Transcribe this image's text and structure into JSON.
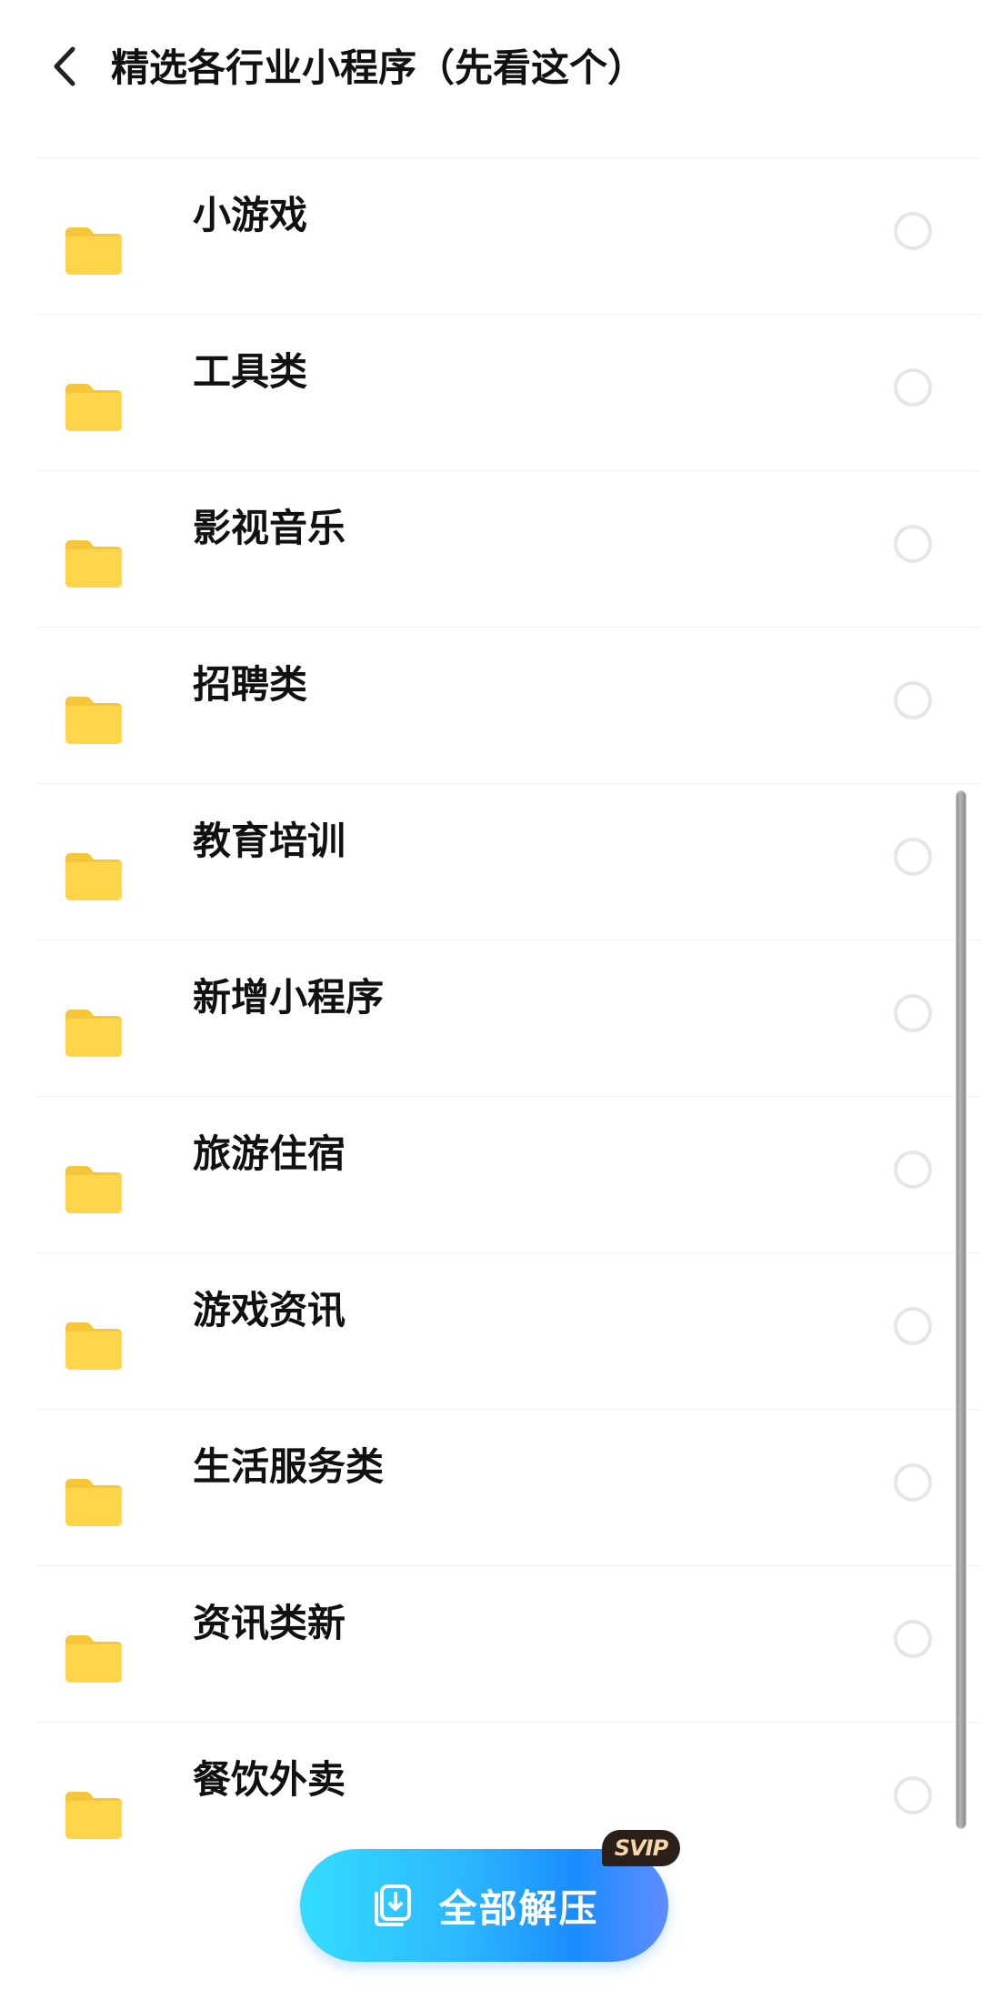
{
  "header": {
    "title": "精选各行业小程序（先看这个）",
    "back_icon": "chevron-left-icon"
  },
  "files": [
    {
      "name": "小游戏",
      "icon": "folder-icon",
      "selected": false
    },
    {
      "name": "工具类",
      "icon": "folder-icon",
      "selected": false
    },
    {
      "name": "影视音乐",
      "icon": "folder-icon",
      "selected": false
    },
    {
      "name": "招聘类",
      "icon": "folder-icon",
      "selected": false
    },
    {
      "name": "教育培训",
      "icon": "folder-icon",
      "selected": false
    },
    {
      "name": "新增小程序",
      "icon": "folder-icon",
      "selected": false
    },
    {
      "name": "旅游住宿",
      "icon": "folder-icon",
      "selected": false
    },
    {
      "name": "游戏资讯",
      "icon": "folder-icon",
      "selected": false
    },
    {
      "name": "生活服务类",
      "icon": "folder-icon",
      "selected": false
    },
    {
      "name": "资讯类新",
      "icon": "folder-icon",
      "selected": false
    },
    {
      "name": "餐饮外卖",
      "icon": "folder-icon",
      "selected": false
    }
  ],
  "footer": {
    "extract_label": "全部解压",
    "badge": "SVIP"
  },
  "colors": {
    "folder": "#FFD54A",
    "folder_tab": "#F5C53A",
    "button_start": "#33DDFF",
    "button_end": "#5F8CFF",
    "badge_bg": "#2B1F1A",
    "badge_text": "#F6D6A8"
  }
}
